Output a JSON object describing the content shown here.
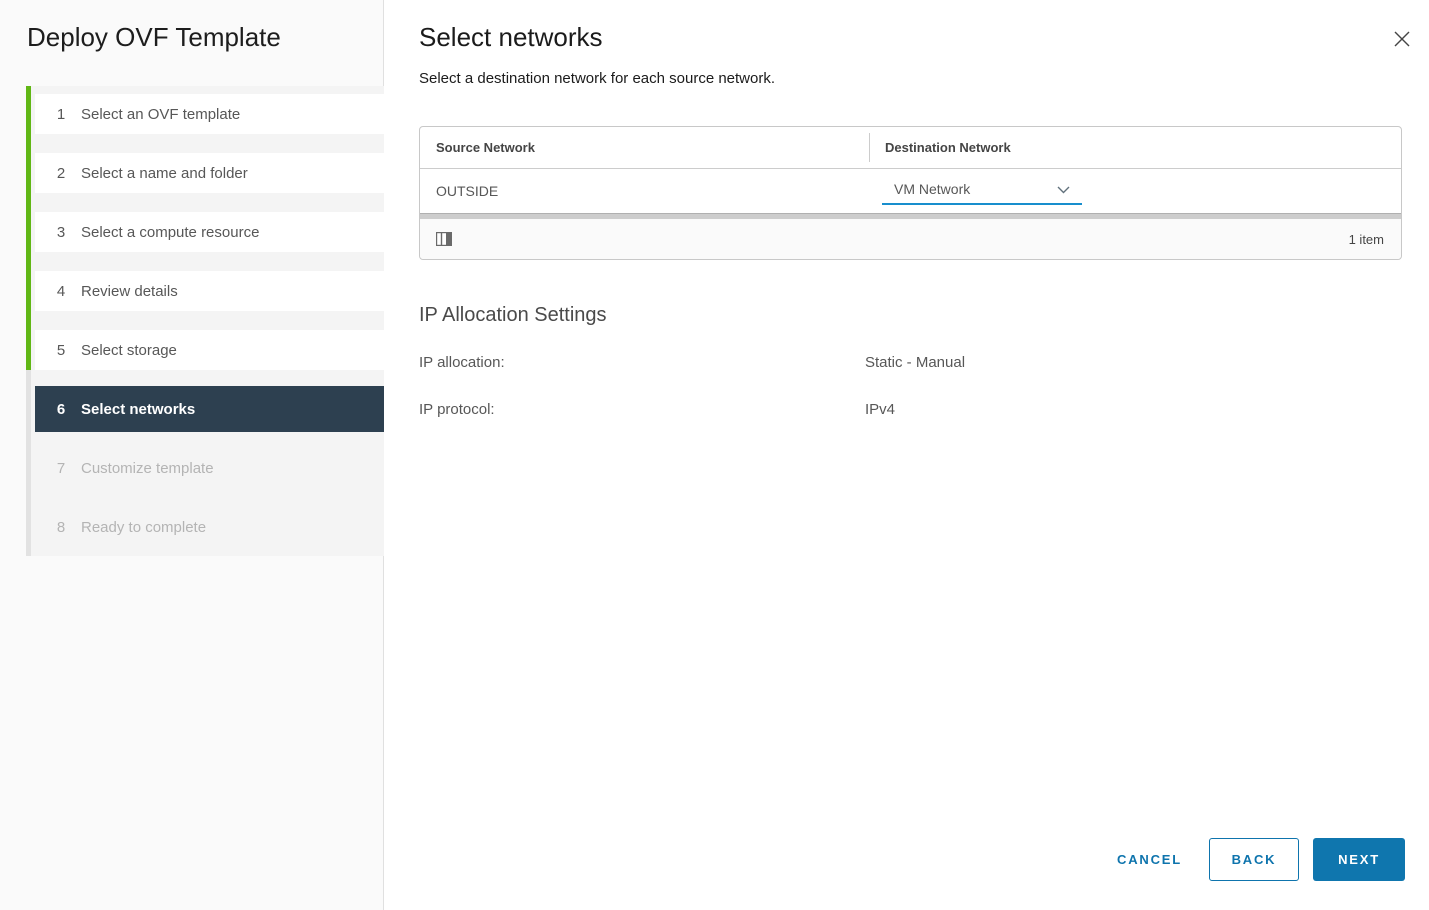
{
  "wizard": {
    "title": "Deploy OVF Template",
    "steps": [
      {
        "number": "1",
        "label": "Select an OVF template",
        "state": "completed"
      },
      {
        "number": "2",
        "label": "Select a name and folder",
        "state": "completed"
      },
      {
        "number": "3",
        "label": "Select a compute resource",
        "state": "completed"
      },
      {
        "number": "4",
        "label": "Review details",
        "state": "completed"
      },
      {
        "number": "5",
        "label": "Select storage",
        "state": "completed"
      },
      {
        "number": "6",
        "label": "Select networks",
        "state": "active"
      },
      {
        "number": "7",
        "label": "Customize template",
        "state": "upcoming"
      },
      {
        "number": "8",
        "label": "Ready to complete",
        "state": "upcoming"
      }
    ]
  },
  "page": {
    "title": "Select networks",
    "subtitle": "Select a destination network for each source network."
  },
  "network_table": {
    "columns": [
      "Source Network",
      "Destination Network"
    ],
    "rows": [
      {
        "source": "OUTSIDE",
        "destination": "VM Network"
      }
    ],
    "footer": {
      "item_count": "1 item",
      "icon": "columns-icon"
    }
  },
  "ip_allocation": {
    "heading": "IP Allocation Settings",
    "rows": [
      {
        "label": "IP allocation:",
        "value": "Static - Manual"
      },
      {
        "label": "IP protocol:",
        "value": "IPv4"
      }
    ]
  },
  "actions": {
    "cancel": "CANCEL",
    "back": "BACK",
    "next": "NEXT"
  },
  "colors": {
    "accent_blue": "#0e74ad",
    "next_button_blue": "#0f76ae",
    "select_underline_blue": "#188ecd",
    "progress_green": "#61b715",
    "active_step_bg": "#2d4050",
    "sidebar_bg": "#fafafa"
  }
}
